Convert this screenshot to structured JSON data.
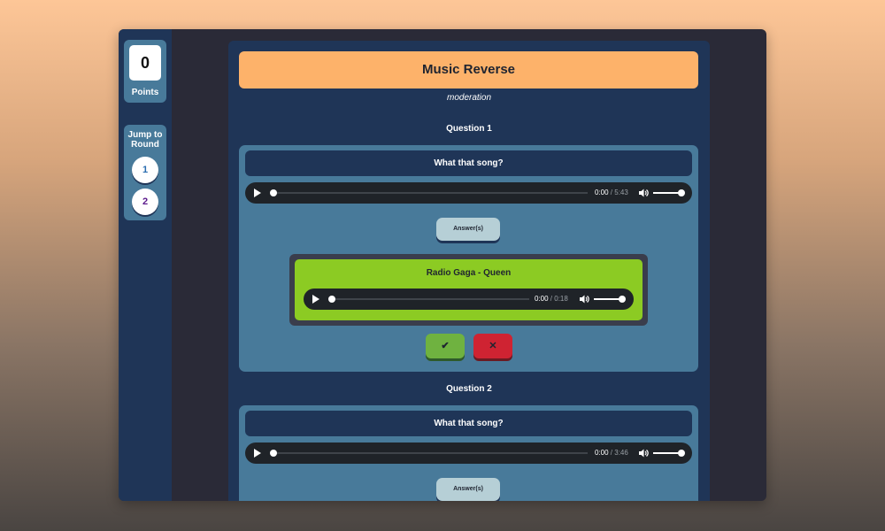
{
  "sidebar": {
    "points_value": "0",
    "points_label": "Points",
    "jump_label_line1": "Jump to",
    "jump_label_line2": "Round",
    "rounds": [
      {
        "label": "1",
        "color": "#2a6db0"
      },
      {
        "label": "2",
        "color": "#5b1a8c"
      }
    ]
  },
  "main": {
    "title": "Music Reverse",
    "subtitle": "moderation",
    "questions": [
      {
        "label": "Question 1",
        "prompt": "What that song?",
        "audio": {
          "current": "0:00",
          "total": " / 5:43",
          "progress": 0
        },
        "answer_button": "Answer(s)",
        "answer": {
          "text": "Radio Gaga - Queen",
          "audio": {
            "current": "0:00",
            "total": " / 0:18",
            "progress": 0
          }
        },
        "correct_symbol": "✔",
        "wrong_symbol": "✕"
      },
      {
        "label": "Question 2",
        "prompt": "What that song?",
        "audio": {
          "current": "0:00",
          "total": " / 3:46",
          "progress": 0
        },
        "answer_button": "Answer(s)"
      }
    ]
  },
  "colors": {
    "accent": "#fdb26a",
    "panel": "#487a9a",
    "navy": "#1f3557",
    "answer_green": "#8ccb23",
    "correct": "#6fb240",
    "wrong": "#cf2332"
  },
  "icons": [
    "play-icon",
    "volume-icon",
    "check-icon",
    "cross-icon"
  ]
}
